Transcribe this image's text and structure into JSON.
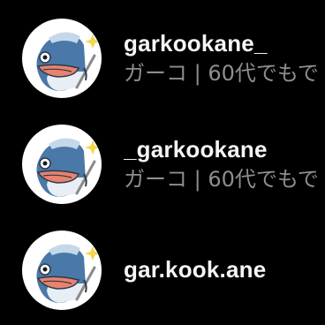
{
  "results": [
    {
      "username": "garkookane_",
      "full_name": "ガーコ | 60代でもで",
      "avatar_icon": "gar-mascot-icon"
    },
    {
      "username": "_garkookane",
      "full_name": "ガーコ | 60代でもで",
      "avatar_icon": "gar-mascot-icon"
    },
    {
      "username": "gar.kook.ane",
      "full_name": "",
      "avatar_icon": "gar-mascot-icon"
    }
  ],
  "colors": {
    "background": "#000000",
    "username": "#f5f5f5",
    "subtitle": "#8e8e8e",
    "avatar_bg": "#ffffff",
    "mascot_blue": "#4a78a8",
    "mascot_mouth": "#e9826f",
    "sparkle": "#f5d54a"
  }
}
